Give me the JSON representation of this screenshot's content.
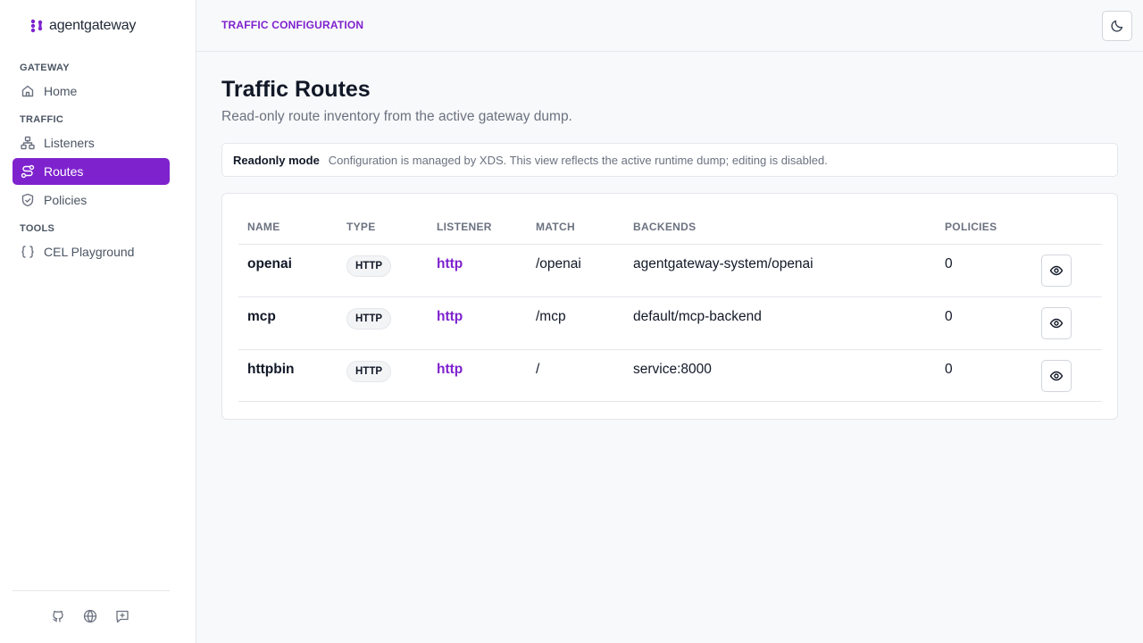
{
  "app": {
    "name": "agentgateway"
  },
  "sidebar": {
    "sections": [
      {
        "label": "GATEWAY"
      },
      {
        "label": "TRAFFIC"
      },
      {
        "label": "TOOLS"
      }
    ],
    "items": [
      {
        "label": "Home",
        "icon": "home-icon"
      },
      {
        "label": "Listeners",
        "icon": "network-icon"
      },
      {
        "label": "Routes",
        "icon": "route-icon",
        "active": true
      },
      {
        "label": "Policies",
        "icon": "shield-check-icon"
      },
      {
        "label": "CEL Playground",
        "icon": "braces-icon"
      }
    ],
    "footer_icons": [
      "github-icon",
      "globe-icon",
      "feedback-icon"
    ]
  },
  "header": {
    "breadcrumb": "TRAFFIC CONFIGURATION",
    "theme_toggle_icon": "moon-icon"
  },
  "main": {
    "title": "Traffic Routes",
    "subtitle": "Read-only route inventory from the active gateway dump.",
    "notice": {
      "label": "Readonly mode",
      "text": "Configuration is managed by XDS. This view reflects the active runtime dump; editing is disabled."
    },
    "table": {
      "columns": [
        "NAME",
        "TYPE",
        "LISTENER",
        "MATCH",
        "BACKENDS",
        "POLICIES"
      ],
      "rows": [
        {
          "name": "openai",
          "type": "HTTP",
          "listener": "http",
          "match": "/openai",
          "backends": "agentgateway-system/openai",
          "policies": "0"
        },
        {
          "name": "mcp",
          "type": "HTTP",
          "listener": "http",
          "match": "/mcp",
          "backends": "default/mcp-backend",
          "policies": "0"
        },
        {
          "name": "httpbin",
          "type": "HTTP",
          "listener": "http",
          "match": "/",
          "backends": "service:8000",
          "policies": "0"
        }
      ]
    }
  },
  "colors": {
    "accent": "#7e22ce",
    "border": "#e5e7eb",
    "muted": "#6b7280",
    "text": "#111827"
  }
}
